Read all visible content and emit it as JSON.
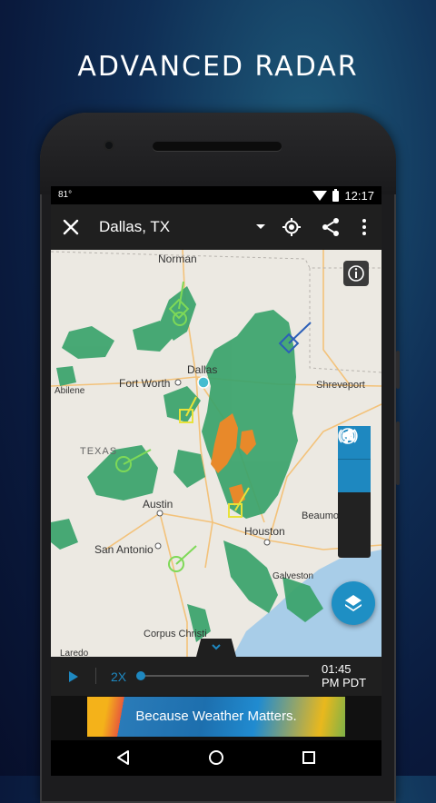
{
  "headline": "ADVANCED RADAR",
  "status_bar": {
    "temperature": "81°",
    "time": "12:17"
  },
  "toolbar": {
    "title": "Dallas, TX",
    "icons": [
      "close-icon",
      "chevron-down-icon",
      "locate-icon",
      "share-icon",
      "more-vert-icon"
    ]
  },
  "map": {
    "labels": {
      "norman": "Norman",
      "dallas": "Dallas",
      "fort_worth": "Fort Worth",
      "abilene": "Abilene",
      "shreveport": "Shreveport",
      "texas": "TEXAS",
      "austin": "Austin",
      "houston": "Houston",
      "beaumont": "Beaumo",
      "san_antonio": "San Antonio",
      "galveston": "Galveston",
      "corpus_christi": "Corpus Christi",
      "laredo": "Laredo"
    },
    "info_icon": "info-icon",
    "layer_tools": [
      "precipitation-icon",
      "radar-icon",
      "lightning-icon",
      "broadcast-icon"
    ],
    "fab_icon": "layers-icon",
    "colors": {
      "radar_green": "#3aa36b",
      "radar_orange": "#e8892a",
      "water": "#a8cde8"
    }
  },
  "playback": {
    "speed": "2X",
    "time_line1": "01:45",
    "time_line2": "PM PDT",
    "progress": 0
  },
  "ad": {
    "text": "Because Weather Matters."
  },
  "nav": [
    "back-icon",
    "home-icon",
    "recents-icon"
  ]
}
